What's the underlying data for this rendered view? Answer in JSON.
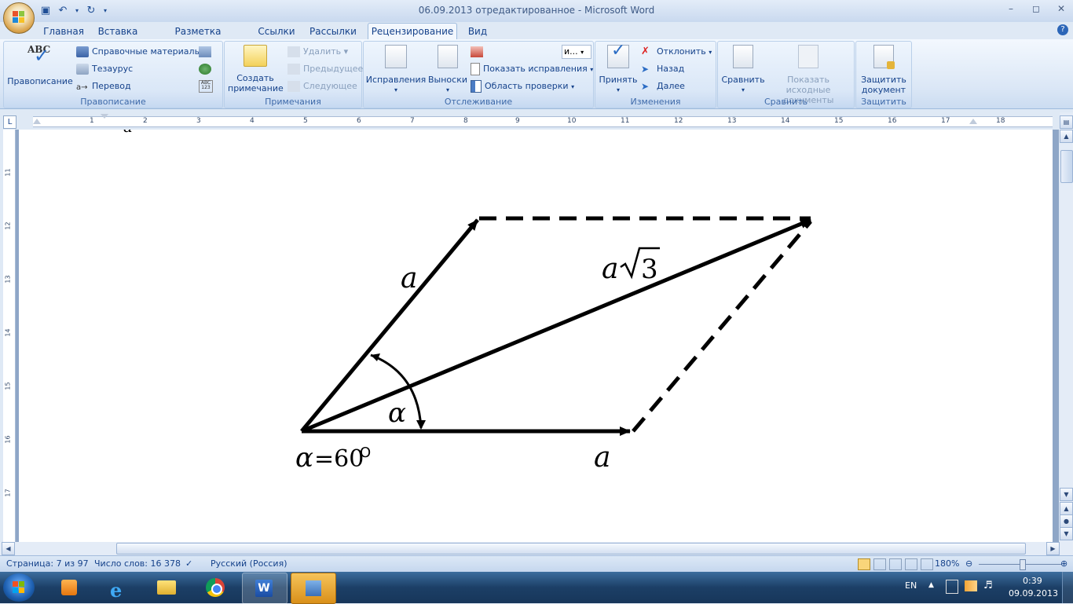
{
  "window": {
    "title": "06.09.2013 отредактированное - Microsoft Word"
  },
  "tabs": [
    {
      "label": "Главная"
    },
    {
      "label": "Вставка"
    },
    {
      "label": "Разметка страницы"
    },
    {
      "label": "Ссылки"
    },
    {
      "label": "Рассылки"
    },
    {
      "label": "Рецензирование",
      "active": true
    },
    {
      "label": "Вид"
    }
  ],
  "ribbon": {
    "spelling": {
      "group_label": "Правописание",
      "spelling_button": "Правописание",
      "abc_icon_text": "ABC",
      "research": "Справочные материалы",
      "thesaurus": "Тезаурус",
      "translate": "Перевод",
      "word_count_icon_text": "ABC\n123"
    },
    "comments": {
      "group_label": "Примечания",
      "new_comment": "Создать примечание",
      "delete": "Удалить",
      "previous": "Предыдущее",
      "next": "Следующее"
    },
    "tracking": {
      "group_label": "Отслеживание",
      "track_changes": "Исправления",
      "balloons": "Выноски",
      "display_dropdown": "и...",
      "show_markup": "Показать исправления",
      "reviewing_pane": "Область проверки"
    },
    "changes": {
      "group_label": "Изменения",
      "accept": "Принять",
      "reject": "Отклонить",
      "previous": "Назад",
      "next": "Далее"
    },
    "compare": {
      "group_label": "Сравнить",
      "compare": "Сравнить",
      "show_source": "Показать исходные документы"
    },
    "protect": {
      "group_label": "Защитить",
      "protect_doc": "Защитить документ"
    }
  },
  "ruler": {
    "h_numbers": [
      "1",
      "1",
      "2",
      "3",
      "4",
      "5",
      "6",
      "7",
      "8",
      "9",
      "10",
      "11",
      "12",
      "13",
      "14",
      "15",
      "16",
      "17",
      "18"
    ],
    "v_numbers": [
      "11",
      "12",
      "13",
      "14",
      "15",
      "16",
      "17"
    ]
  },
  "figure": {
    "label_left": "a",
    "label_diagonal": "a",
    "sqrt_arg": "3",
    "label_alpha": "α",
    "angle_note_alpha": "α",
    "angle_note_value": "=60",
    "angle_note_degree": "O",
    "label_bottom": "a"
  },
  "status": {
    "page": "Страница: 7 из 97",
    "words": "Число слов: 16 378",
    "language": "Русский (Россия)",
    "zoom": "180%"
  },
  "taskbar": {
    "lang": "EN",
    "time": "0:39",
    "date": "09.09.2013"
  },
  "colors": {
    "ribbon_text": "#15428b",
    "taskbar": "#1c3f66"
  }
}
